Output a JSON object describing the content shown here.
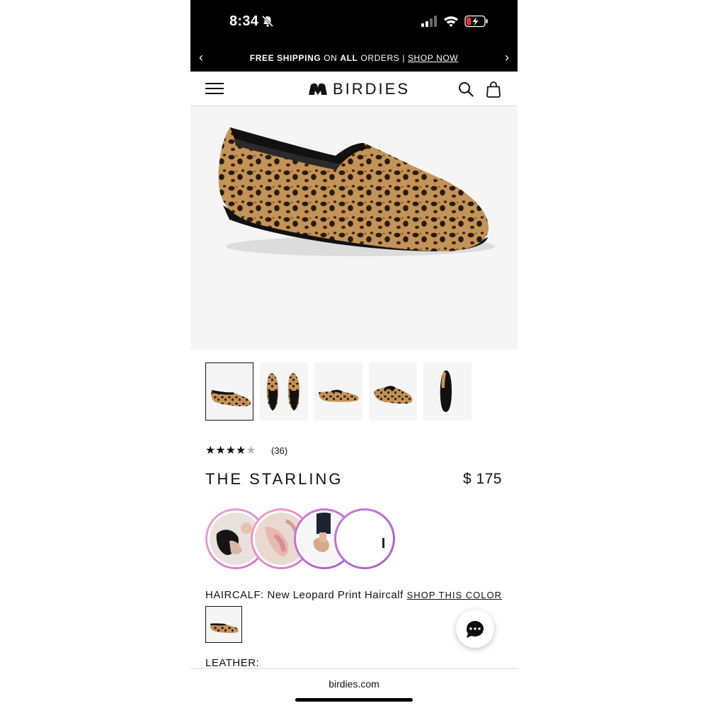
{
  "status": {
    "time": "8:34"
  },
  "announcement": {
    "part1_bold": "FREE SHIPPING",
    "part2": " ON ",
    "part3_bold": "ALL",
    "part4": " ORDERS | ",
    "link": "SHOP NOW",
    "prev_icon": "chevron-left-icon",
    "next_icon": "chevron-right-icon"
  },
  "header": {
    "brand": "BIRDIES",
    "icons": [
      "menu-icon",
      "search-icon",
      "shopping-bag-icon"
    ]
  },
  "gallery": {
    "selected_index": 0,
    "thumbnail_views": [
      "side",
      "top-pair",
      "side-flat",
      "three-quarter",
      "sole"
    ]
  },
  "product": {
    "rating": 4,
    "rating_max": 5,
    "review_count": "(36)",
    "name": "THE STARLING",
    "price": "$ 175"
  },
  "stories": {
    "count": 4,
    "ring_colors": [
      "#e58fc9",
      "#d877c8",
      "#c36ad6",
      "#b25ed0"
    ]
  },
  "color": {
    "label": "HAIRCALF: New Leopard Print Haircalf",
    "shop_link": "SHOP THIS COLOR",
    "next_group_label": "LEATHER:"
  },
  "chat": {
    "icon": "chat-bubble-icon"
  },
  "browser": {
    "url": "birdies.com"
  },
  "colors": {
    "leopard_base": "#b98a4e",
    "leopard_spot": "#2b1a0e",
    "gallery_bg": "#f5f5f5"
  }
}
